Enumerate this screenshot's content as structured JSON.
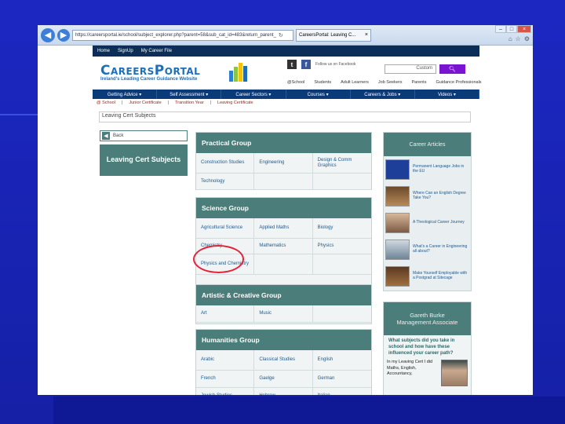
{
  "browser": {
    "url": "https://careersportal.ie/school/subject_explorer.php?parent=58&sub_cat_id=483&return_parent_",
    "tab_title": "CareersPortal: Leaving C..."
  },
  "site": {
    "topbar": [
      "Home",
      "SignUp",
      "My Career File"
    ],
    "logo_text": "CareersPortal",
    "logo_tagline": "Ireland's Leading Career Guidance Website",
    "social_text": "Follow us on Facebook",
    "search_placeholder": "Custom",
    "audience": [
      "@School",
      "Students",
      "Adult Learners",
      "Job Seekers",
      "Parents",
      "Guidance Professionals"
    ],
    "main_nav": [
      "Getting Advice ▾",
      "Self Assessment ▾",
      "Career Sectors ▾",
      "Courses ▾",
      "Careers & Jobs ▾",
      "Videos ▾"
    ],
    "sub_nav": [
      "@ School",
      "Junior Certificate",
      "Transition Year",
      "Leaving Certificate"
    ],
    "breadcrumb": "Leaving Cert Subjects"
  },
  "sidebar": {
    "back_label": "Back",
    "title": "Leaving Cert Subjects"
  },
  "groups": {
    "practical": {
      "title": "Practical Group",
      "subjects": [
        "Construction Studies",
        "Engineering",
        "Design & Comm Graphics",
        "Technology",
        "",
        ""
      ]
    },
    "science": {
      "title": "Science Group",
      "subjects": [
        "Agricultural Science",
        "Applied Maths",
        "Biology",
        "Chemistry",
        "Mathematics",
        "Physics",
        "Physics and Chemistry",
        "",
        ""
      ]
    },
    "artistic": {
      "title": "Artistic & Creative Group",
      "subjects": [
        "Art",
        "Music",
        ""
      ]
    },
    "humanities": {
      "title": "Humanities Group",
      "subjects": [
        "Arabic",
        "Classical Studies",
        "English",
        "French",
        "Gaelge",
        "German",
        "Jewish Studies",
        "Hebrew",
        "Italian"
      ]
    }
  },
  "articles": {
    "title": "Career Articles",
    "items": [
      "Permanent Language Jobs in the EU",
      "Where Can an English Degree Take You?",
      "A Theological Career Journey",
      "What's a Career in Engineering all about?",
      "Make Yourself Employable with a Postgrad at Sitecage"
    ]
  },
  "profile": {
    "name": "Gareth Burke",
    "role": "Management Associate",
    "question": "What subjects did you take in school and how have these influenced your career path?",
    "answer": "In my Leaving Cert I did Maths, English, Accountancy,"
  }
}
